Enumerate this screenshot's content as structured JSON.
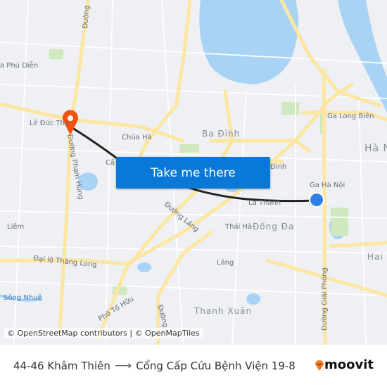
{
  "map": {
    "labels": {
      "phu_dien": "a Phú Diễn",
      "le_duc_tho": "Lê Đức Thọ",
      "chua_ha": "Chùa Hà",
      "ba_dinh": "Ba Đình",
      "ga_long_bien": "Ga Long Biên",
      "ha_noi": "Hà N",
      "cau": "Cầ",
      "dinh": "Đình",
      "ga_ha_noi": "Ga Hà Nội",
      "la_thanh": "La Thành",
      "thai_ha": "Thái Hà",
      "dong_da": "Đống Đa",
      "lang": "Láng",
      "thanh_xuan": "Thanh Xuân",
      "liem": "Liêm",
      "song_nhue": "Sông Nhuệ",
      "hai_ba": "Hai B",
      "duong_pham_hung": "Đường Phạm Hùng",
      "duong_lang": "Đường Láng",
      "dai_lo_thang_long": "Đại lộ Thăng Long",
      "pho_to_huu": "Phố Tố Hữu",
      "duong_giai_phong": "Đường Giải Phóng",
      "duong_top": "Đường",
      "duong_bottom": "Đường"
    },
    "colors": {
      "route": "#222222",
      "origin": "#2f7fe6",
      "destination": "#f0520f",
      "water": "#a9d3f5",
      "road": "#fbe6a2",
      "park": "#cfe8c0"
    },
    "origin_icon": "origin-dot-icon",
    "destination_icon": "destination-pin-icon"
  },
  "cta": {
    "label": "Take me there"
  },
  "attribution": "© OpenStreetMap contributors | © OpenMapTiles",
  "footer": {
    "from": "44-46 Khâm Thiên",
    "arrow": "⟶",
    "to": "Cổng Cấp Cứu Bệnh Viện 19-8",
    "logo": "moovit"
  }
}
